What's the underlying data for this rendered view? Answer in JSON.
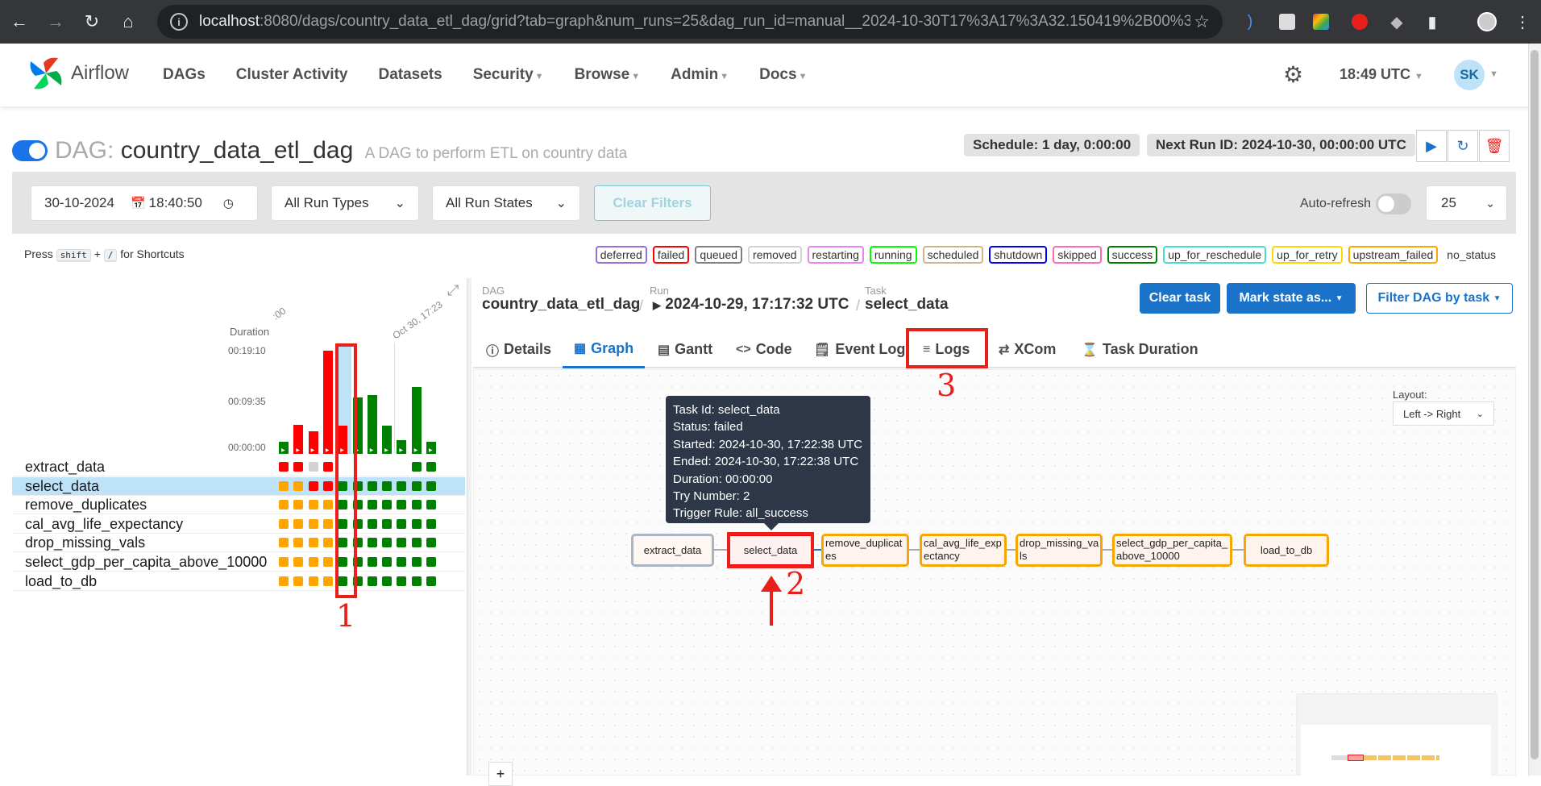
{
  "browser": {
    "url_host": "localhost",
    "url_rest": ":8080/dags/country_data_etl_dag/grid?tab=graph&num_runs=25&dag_run_id=manual__2024-10-30T17%3A17%3A32.150419%2B00%3A00&task_i..."
  },
  "nav": {
    "brand": "Airflow",
    "items": [
      "DAGs",
      "Cluster Activity",
      "Datasets",
      "Security",
      "Browse",
      "Admin",
      "Docs"
    ],
    "time": "18:49 UTC",
    "user_initials": "SK"
  },
  "dag": {
    "label": "DAG:",
    "name": "country_data_etl_dag",
    "description": "A DAG to perform ETL on country data",
    "schedule": "Schedule: 1 day, 0:00:00",
    "next_run": "Next Run ID: 2024-10-30, 00:00:00 UTC"
  },
  "filters": {
    "date": "30-10-2024",
    "time": "18:40:50",
    "run_types": "All Run Types",
    "run_states": "All Run States",
    "clear": "Clear Filters",
    "autorefresh": "Auto-refresh",
    "num_runs": "25"
  },
  "shortcuts": {
    "press": "Press",
    "key1": "shift",
    "plus": "+",
    "key2": "/",
    "suffix": "for Shortcuts"
  },
  "states": [
    {
      "label": "deferred",
      "color": "#9370db"
    },
    {
      "label": "failed",
      "color": "#ff0000"
    },
    {
      "label": "queued",
      "color": "#808080"
    },
    {
      "label": "removed",
      "color": "#d3d3d3"
    },
    {
      "label": "restarting",
      "color": "#ee82ee"
    },
    {
      "label": "running",
      "color": "#00ff00"
    },
    {
      "label": "scheduled",
      "color": "#d2b48c"
    },
    {
      "label": "shutdown",
      "color": "#0000ff"
    },
    {
      "label": "skipped",
      "color": "#ff69b4"
    },
    {
      "label": "success",
      "color": "#008000"
    },
    {
      "label": "up_for_reschedule",
      "color": "#40e0d0"
    },
    {
      "label": "up_for_retry",
      "color": "#ffd700"
    },
    {
      "label": "upstream_failed",
      "color": "#ffa500"
    },
    {
      "label": "no_status",
      "color": ""
    }
  ],
  "grid": {
    "duration_label": "Duration",
    "ticks": [
      "00:19:10",
      "00:09:35",
      "00:00:00"
    ],
    "date_labels": [
      ":00",
      "Oct 30, 17:23"
    ],
    "bars": [
      {
        "value": 0.12,
        "state": "success"
      },
      {
        "value": 0.28,
        "state": "failed"
      },
      {
        "value": 0.22,
        "state": "failed"
      },
      {
        "value": 1.0,
        "state": "failed"
      },
      {
        "value": 0.27,
        "state": "failed"
      },
      {
        "value": 0.55,
        "state": "success"
      },
      {
        "value": 0.57,
        "state": "success"
      },
      {
        "value": 0.27,
        "state": "success"
      },
      {
        "value": 0.13,
        "state": "success"
      },
      {
        "value": 0.65,
        "state": "success"
      },
      {
        "value": 0.12,
        "state": "success"
      }
    ],
    "tasks": [
      "extract_data",
      "select_data",
      "remove_duplicates",
      "cal_avg_life_expectancy",
      "drop_missing_vals",
      "select_gdp_per_capita_above_10000",
      "load_to_db"
    ],
    "selected_task": 1,
    "cells": [
      [
        "failed",
        "failed",
        "removed",
        "failed",
        "",
        "",
        "",
        "",
        "",
        "success",
        "success"
      ],
      [
        "upstream_failed",
        "upstream_failed",
        "failed",
        "failed",
        "success",
        "success",
        "success",
        "success",
        "success",
        "success",
        "success"
      ],
      [
        "upstream_failed",
        "upstream_failed",
        "upstream_failed",
        "upstream_failed",
        "success",
        "success",
        "success",
        "success",
        "success",
        "success",
        "success"
      ],
      [
        "upstream_failed",
        "upstream_failed",
        "upstream_failed",
        "upstream_failed",
        "success",
        "success",
        "success",
        "success",
        "success",
        "success",
        "success"
      ],
      [
        "upstream_failed",
        "upstream_failed",
        "upstream_failed",
        "upstream_failed",
        "success",
        "success",
        "success",
        "success",
        "success",
        "success",
        "success"
      ],
      [
        "upstream_failed",
        "upstream_failed",
        "upstream_failed",
        "upstream_failed",
        "success",
        "success",
        "success",
        "success",
        "success",
        "success",
        "success"
      ],
      [
        "upstream_failed",
        "upstream_failed",
        "upstream_failed",
        "upstream_failed",
        "success",
        "success",
        "success",
        "success",
        "success",
        "success",
        "success"
      ]
    ]
  },
  "breadcrumb": {
    "dag_label": "DAG",
    "dag_value": "country_data_etl_dag",
    "run_label": "Run",
    "run_value": "2024-10-29, 17:17:32 UTC",
    "task_label": "Task",
    "task_value": "select_data"
  },
  "actions": {
    "clear_task": "Clear task",
    "mark_state": "Mark state as...",
    "filter_dag": "Filter DAG by task"
  },
  "tabs": [
    {
      "label": "Details",
      "icon": "info-icon"
    },
    {
      "label": "Graph",
      "icon": "graph-icon"
    },
    {
      "label": "Gantt",
      "icon": "gantt-icon"
    },
    {
      "label": "Code",
      "icon": "code-icon"
    },
    {
      "label": "Event Log",
      "icon": "event-log-icon"
    },
    {
      "label": "Logs",
      "icon": "list-icon"
    },
    {
      "label": "XCom",
      "icon": "arrows-icon"
    },
    {
      "label": "Task Duration",
      "icon": "hourglass-icon"
    }
  ],
  "active_tab": "Graph",
  "layout": {
    "label": "Layout:",
    "value": "Left -> Right"
  },
  "tooltip": {
    "task_id": "Task Id: select_data",
    "status": "Status: failed",
    "started": "Started: 2024-10-30, 17:22:38 UTC",
    "ended": "Ended: 2024-10-30, 17:22:38 UTC",
    "duration": "Duration: 00:00:00",
    "try_number": "Try Number: 2",
    "trigger_rule": "Trigger Rule: all_success"
  },
  "nodes": [
    {
      "label": "extract_data",
      "state": "removed"
    },
    {
      "label": "select_data",
      "state": "failed"
    },
    {
      "label": "remove_duplicates",
      "state": "upstream_failed"
    },
    {
      "label": "cal_avg_life_expectancy",
      "state": "upstream_failed"
    },
    {
      "label": "drop_missing_vals",
      "state": "upstream_failed"
    },
    {
      "label": "select_gdp_per_capita_above_10000",
      "state": "upstream_failed"
    },
    {
      "label": "load_to_db",
      "state": "upstream_failed"
    }
  ],
  "node_lines": [
    [
      "extract_data"
    ],
    [
      "select_data"
    ],
    [
      "remove_duplicat",
      "es"
    ],
    [
      "cal_avg_life_exp",
      "ectancy"
    ],
    [
      "drop_missing_va",
      "ls"
    ],
    [
      "select_gdp_per_capita_",
      "above_10000"
    ],
    [
      "load_to_db"
    ]
  ],
  "annotations": [
    "1",
    "2",
    "3"
  ],
  "colors": {
    "success": "#008000",
    "failed": "#ff0000",
    "upstream_failed": "#ffa500",
    "removed": "#d3d3d3",
    "accent": "#1a73c8",
    "annotation": "#e8201c"
  }
}
